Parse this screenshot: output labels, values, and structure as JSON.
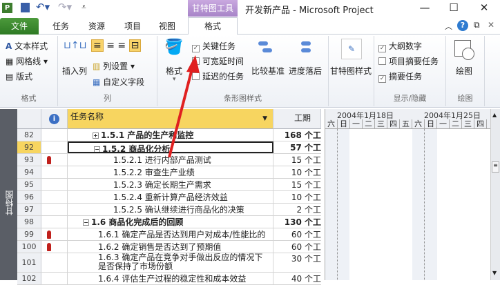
{
  "titlebar": {
    "context_tab": "甘特图工具",
    "title": "开发新产品 - Microsoft Project",
    "minimize": "—",
    "maximize": "☐",
    "close": "✕"
  },
  "tabs": {
    "file": "文件",
    "items": [
      "任务",
      "资源",
      "项目",
      "视图"
    ],
    "format": "格式"
  },
  "ribbon": {
    "format_group": {
      "label": "格式",
      "text_styles": "文本样式",
      "gridlines": "网格线",
      "layout": "版式"
    },
    "columns_group": {
      "label": "列",
      "insert_column": "插入列",
      "column_settings": "列设置",
      "custom_fields": "自定义字段"
    },
    "bar_styles_group": {
      "label": "条形图样式",
      "format": "格式",
      "critical_tasks": "关键任务",
      "slack": "可宽延时间",
      "late_tasks": "延迟的任务",
      "baseline": "比较基准",
      "slippage": "进度落后",
      "critical_checked": true,
      "slack_checked": false,
      "late_checked": false
    },
    "gantt_style_group": {
      "gantt_styles": "甘特图样式"
    },
    "show_hide_group": {
      "label": "显示/隐藏",
      "outline_number": "大纲数字",
      "project_summary": "项目摘要任务",
      "summary_tasks": "摘要任务",
      "outline_checked": true,
      "project_summary_checked": false,
      "summary_checked": true
    },
    "drawing_group": {
      "label": "绘图",
      "drawing": "绘图"
    }
  },
  "sidebar": {
    "view_label": "甘特图"
  },
  "table": {
    "col_name": "任务名称",
    "col_duration": "工期",
    "rows": [
      {
        "id": "82",
        "name": "1.5.1 产品的生产和监控",
        "duration": "168 个工",
        "level": 2,
        "summary": true,
        "collapsed": true
      },
      {
        "id": "92",
        "name": "1.5.2 商品化分析",
        "duration": "57 个工",
        "level": 2,
        "summary": true,
        "selected": true
      },
      {
        "id": "93",
        "name": "1.5.2.1 进行内部产品测试",
        "duration": "15 个工",
        "level": 3,
        "resource": true
      },
      {
        "id": "94",
        "name": "1.5.2.2 审查生产业绩",
        "duration": "10 个工",
        "level": 3
      },
      {
        "id": "95",
        "name": "1.5.2.3 确定长期生产需求",
        "duration": "15 个工",
        "level": 3
      },
      {
        "id": "96",
        "name": "1.5.2.4 重新计算产品经济效益",
        "duration": "10 个工",
        "level": 3
      },
      {
        "id": "97",
        "name": "1.5.2.5 确认继续进行商品化的决策",
        "duration": "2 个工",
        "level": 3
      },
      {
        "id": "98",
        "name": "1.6 商品化完成后的回顾",
        "duration": "130 个工",
        "level": 1,
        "summary": true
      },
      {
        "id": "99",
        "name": "1.6.1 确定产品是否达到用户对成本/性能比的",
        "duration": "60 个工",
        "level": 2,
        "resource": true
      },
      {
        "id": "100",
        "name": "1.6.2 确定销售是否达到了预期值",
        "duration": "60 个工",
        "level": 2,
        "resource": true
      },
      {
        "id": "101",
        "name": "1.6.3 确定产品在竞争对手做出反应的情况下",
        "name2": "是否保持了市场份额",
        "duration": "30 个工",
        "level": 2
      },
      {
        "id": "102",
        "name": "1.6.4 评估生产过程的稳定性和成本效益",
        "duration": "40 个工",
        "level": 2
      }
    ]
  },
  "gantt": {
    "week1": "2004年1月18日",
    "week2": "2004年1月25日",
    "days": [
      "六",
      "日",
      "一",
      "二",
      "三",
      "四",
      "五",
      "六",
      "日",
      "一",
      "二",
      "三",
      "四"
    ]
  },
  "colors": {
    "file_tab": "#3a8a2e",
    "context_tab": "#b48fd4",
    "header_highlight": "#f7d560",
    "arrow": "#e02020"
  }
}
